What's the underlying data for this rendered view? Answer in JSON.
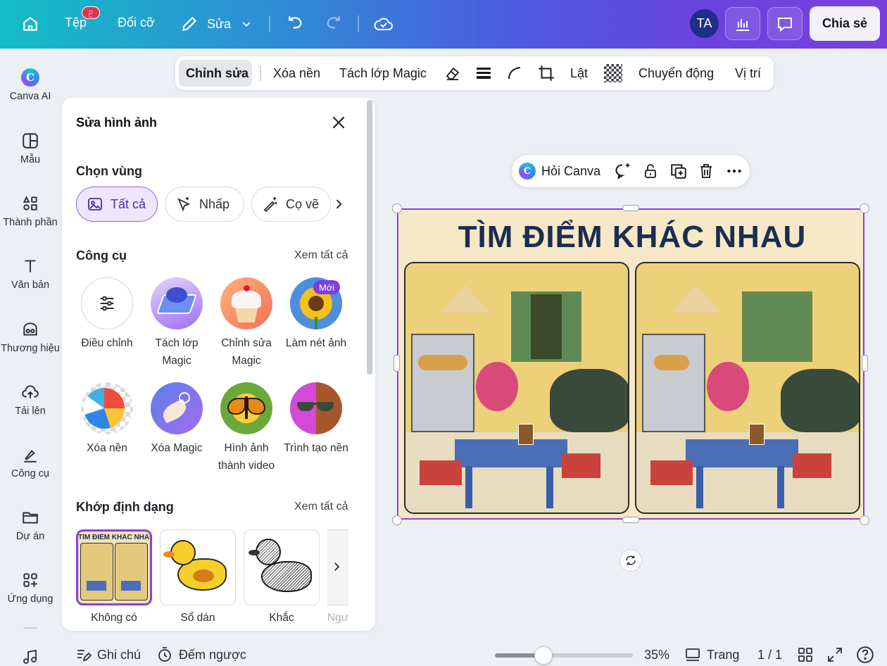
{
  "topbar": {
    "file_label": "Tệp",
    "file_badge": "ဥ",
    "resize_label": "Đổi cỡ",
    "edit_label": "Sửa",
    "avatar_initials": "TA",
    "share_label": "Chia sẻ"
  },
  "rail": {
    "items": [
      {
        "label": "Canva AI",
        "icon": "canva-ai-icon"
      },
      {
        "label": "Mẫu",
        "icon": "templates-icon"
      },
      {
        "label": "Thành phần",
        "icon": "elements-icon"
      },
      {
        "label": "Văn bản",
        "icon": "text-icon"
      },
      {
        "label": "Thương hiệu",
        "icon": "brand-icon"
      },
      {
        "label": "Tải lên",
        "icon": "upload-icon"
      },
      {
        "label": "Công cụ",
        "icon": "tools-icon"
      },
      {
        "label": "Dự án",
        "icon": "projects-icon"
      },
      {
        "label": "Ứng dụng",
        "icon": "apps-icon"
      }
    ]
  },
  "panel": {
    "title": "Sửa hình ảnh",
    "select_area_title": "Chọn vùng",
    "chips": [
      "Tất cả",
      "Nhấp",
      "Cọ vẽ"
    ],
    "tools_title": "Công cụ",
    "see_all": "Xem tất cả",
    "tools": [
      {
        "label": "Điều chỉnh"
      },
      {
        "label": "Tách lớp Magic"
      },
      {
        "label": "Chỉnh sửa Magic"
      },
      {
        "label": "Làm nét ảnh",
        "badge": "Mới"
      },
      {
        "label": "Xóa nền"
      },
      {
        "label": "Xóa Magic"
      },
      {
        "label": "Hình ảnh thành video"
      },
      {
        "label": "Trình tạo nền"
      }
    ],
    "match_title": "Khớp định dạng",
    "match_see_all": "Xem tất cả",
    "formats": [
      "Không có",
      "Sổ dán",
      "Khắc",
      "Ngư"
    ]
  },
  "context_toolbar": {
    "items": [
      "Chỉnh sửa",
      "Xóa nền",
      "Tách lớp Magic",
      "Lật",
      "Chuyển động",
      "Vị trí"
    ]
  },
  "float_toolbar": {
    "ask_label": "Hỏi Canva"
  },
  "canvas": {
    "puzzle_title": "TÌM ĐIỂM KHÁC NHAU"
  },
  "bottom": {
    "notes": "Ghi chú",
    "timer": "Đếm ngược",
    "zoom": "35%",
    "zoom_level": 0.35,
    "pages_label": "Trang",
    "page_count": "1 / 1"
  },
  "colors": {
    "accent": "#8b3fdc",
    "topbar_start": "#14bcc6",
    "topbar_end": "#7b3fdd"
  }
}
